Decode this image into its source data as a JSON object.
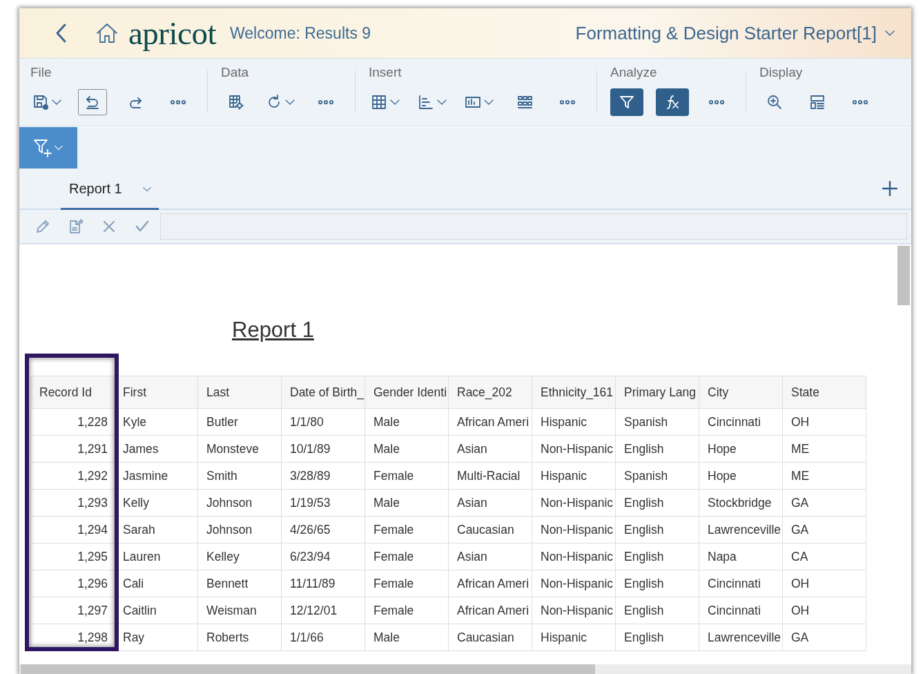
{
  "header": {
    "logo": "apricot",
    "welcome": "Welcome: Results 9",
    "report_title": "Formatting & Design Starter Report[1]"
  },
  "toolbar": [
    {
      "label": "File",
      "tools": [
        {
          "kind": "save",
          "dropdown": true,
          "active": false,
          "focused": false
        },
        {
          "kind": "undo",
          "dropdown": false,
          "active": false,
          "focused": true
        },
        {
          "kind": "redo",
          "dropdown": false,
          "active": false,
          "focused": false
        },
        {
          "kind": "more",
          "dropdown": false,
          "active": false,
          "focused": false
        }
      ]
    },
    {
      "label": "Data",
      "tools": [
        {
          "kind": "grid-settings",
          "dropdown": false,
          "active": false,
          "focused": false
        },
        {
          "kind": "refresh",
          "dropdown": true,
          "active": false,
          "focused": false
        },
        {
          "kind": "more",
          "dropdown": false,
          "active": false,
          "focused": false
        }
      ]
    },
    {
      "label": "Insert",
      "tools": [
        {
          "kind": "table",
          "dropdown": true,
          "active": false,
          "focused": false
        },
        {
          "kind": "chart",
          "dropdown": true,
          "active": false,
          "focused": false
        },
        {
          "kind": "text",
          "dropdown": true,
          "active": false,
          "focused": false
        },
        {
          "kind": "grid",
          "dropdown": false,
          "active": false,
          "focused": false
        },
        {
          "kind": "more",
          "dropdown": false,
          "active": false,
          "focused": false
        }
      ]
    },
    {
      "label": "Analyze",
      "tools": [
        {
          "kind": "filter",
          "dropdown": false,
          "active": true,
          "focused": false
        },
        {
          "kind": "formula",
          "dropdown": false,
          "active": true,
          "focused": false
        },
        {
          "kind": "more",
          "dropdown": false,
          "active": false,
          "focused": false
        }
      ]
    },
    {
      "label": "Display",
      "tools": [
        {
          "kind": "zoom",
          "dropdown": false,
          "active": false,
          "focused": false
        },
        {
          "kind": "layout",
          "dropdown": false,
          "active": false,
          "focused": false
        },
        {
          "kind": "more",
          "dropdown": false,
          "active": false,
          "focused": false
        }
      ]
    }
  ],
  "tabs": [
    {
      "label": "Report 1",
      "selected": true
    }
  ],
  "report": {
    "title": "Report 1"
  },
  "table": {
    "columns": [
      {
        "label": "Record Id",
        "highlighted": true
      },
      {
        "label": "First",
        "highlighted": false
      },
      {
        "label": "Last",
        "highlighted": false
      },
      {
        "label": "Date of Birth_",
        "highlighted": false
      },
      {
        "label": "Gender Identi",
        "highlighted": false
      },
      {
        "label": "Race_202",
        "highlighted": false
      },
      {
        "label": "Ethnicity_161",
        "highlighted": false
      },
      {
        "label": "Primary Lang",
        "highlighted": false
      },
      {
        "label": "City",
        "highlighted": false
      },
      {
        "label": "State",
        "highlighted": false
      }
    ],
    "rows": [
      [
        "1,228",
        "Kyle",
        "Butler",
        "1/1/80",
        "Male",
        "African Ameri",
        "Hispanic",
        "Spanish",
        "Cincinnati",
        "OH"
      ],
      [
        "1,291",
        "James",
        "Monsteve",
        "10/1/89",
        "Male",
        "Asian",
        "Non-Hispanic",
        "English",
        "Hope",
        "ME"
      ],
      [
        "1,292",
        "Jasmine",
        "Smith",
        "3/28/89",
        "Female",
        "Multi-Racial",
        "Hispanic",
        "Spanish",
        "Hope",
        "ME"
      ],
      [
        "1,293",
        "Kelly",
        "Johnson",
        "1/19/53",
        "Male",
        "Asian",
        "Non-Hispanic",
        "English",
        "Stockbridge",
        "GA"
      ],
      [
        "1,294",
        "Sarah",
        "Johnson",
        "4/26/65",
        "Female",
        "Caucasian",
        "Non-Hispanic",
        "English",
        "Lawrenceville",
        "GA"
      ],
      [
        "1,295",
        "Lauren",
        "Kelley",
        "6/23/94",
        "Female",
        "Asian",
        "Non-Hispanic",
        "English",
        "Napa",
        "CA"
      ],
      [
        "1,296",
        "Cali",
        "Bennett",
        "11/11/89",
        "Female",
        "African Ameri",
        "Non-Hispanic",
        "English",
        "Cincinnati",
        "OH"
      ],
      [
        "1,297",
        "Caitlin",
        "Weisman",
        "12/12/01",
        "Female",
        "African Ameri",
        "Non-Hispanic",
        "English",
        "Cincinnati",
        "OH"
      ],
      [
        "1,298",
        "Ray",
        "Roberts",
        "1/1/66",
        "Male",
        "Caucasian",
        "Hispanic",
        "English",
        "Lawrenceville",
        "GA"
      ]
    ]
  }
}
